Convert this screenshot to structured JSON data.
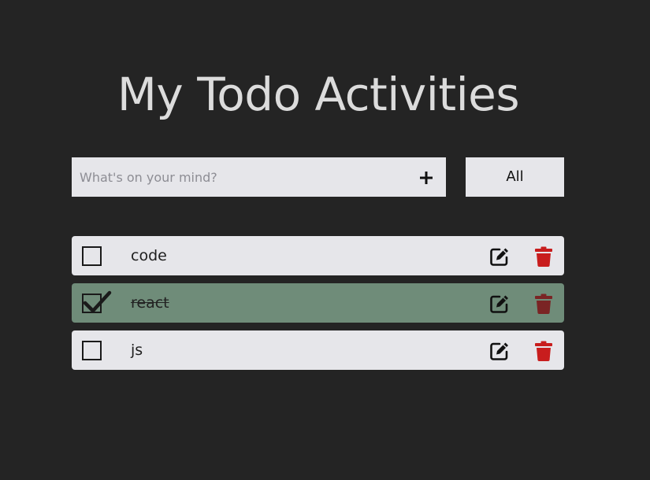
{
  "header": {
    "title": "My Todo Activities"
  },
  "form": {
    "placeholder": "What's on your mind?",
    "value": "",
    "add_icon": "plus-icon"
  },
  "filter": {
    "selected": "All"
  },
  "todos": [
    {
      "text": "code",
      "completed": false
    },
    {
      "text": "react",
      "completed": true
    },
    {
      "text": "js",
      "completed": false
    }
  ],
  "colors": {
    "background": "#242424",
    "item": "#e6e6ea",
    "completed_item": "#6f8c79",
    "delete": "#c81d1d",
    "delete_completed": "#7a2424",
    "edit": "#111111"
  },
  "icons": {
    "edit": "edit-icon",
    "delete": "trash-icon",
    "check": "checkmark-icon"
  }
}
